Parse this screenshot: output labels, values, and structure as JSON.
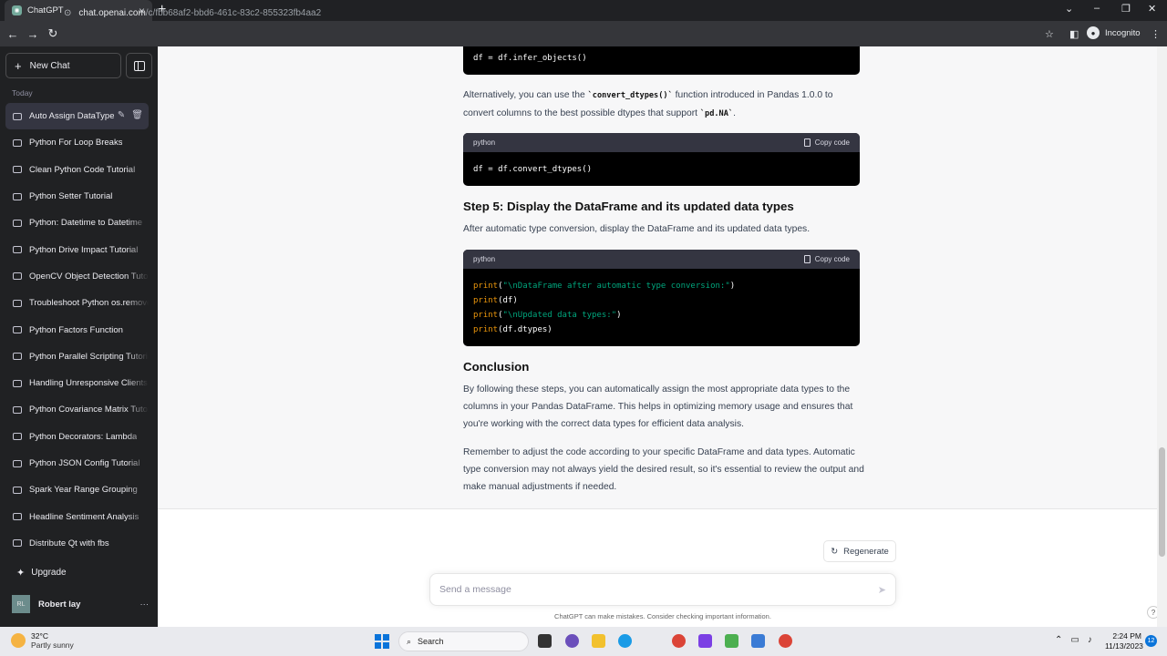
{
  "browser": {
    "tab_title": "ChatGPT",
    "url_host": "chat.openai.com",
    "url_path": "/c/fbb68af2-bbd6-461c-83c2-855323fb4aa2",
    "profile_label": "Incognito"
  },
  "sidebar": {
    "new_chat_label": "New Chat",
    "section_label": "Today",
    "chats": [
      "Auto Assign DataType",
      "Python For Loop Breaks",
      "Clean Python Code Tutorial",
      "Python Setter Tutorial",
      "Python: Datetime to Datetime",
      "Python Drive Impact Tutorial",
      "OpenCV Object Detection Tutorial",
      "Troubleshoot Python os.remove",
      "Python Factors Function",
      "Python Parallel Scripting Tutorial",
      "Handling Unresponsive Clients",
      "Python Covariance Matrix Tutorial",
      "Python Decorators: Lambda",
      "Python JSON Config Tutorial",
      "Spark Year Range Grouping",
      "Headline Sentiment Analysis",
      "Distribute Qt with fbs"
    ],
    "upgrade_label": "Upgrade",
    "user_initials": "RL",
    "user_name": "Robert lay"
  },
  "content": {
    "code1_line": "df = df.infer_objects()",
    "para1_pre": "Alternatively, you can use the ",
    "para1_code1": "`convert_dtypes()`",
    "para1_mid": " function introduced in Pandas 1.0.0 to convert columns to the best possible dtypes that support ",
    "para1_code2": "`pd.NA`",
    "para1_post": ".",
    "code_lang": "python",
    "copy_label": "Copy code",
    "code2_line": "df = df.convert_dtypes()",
    "step5_heading": "Step 5: Display the DataFrame and its updated data types",
    "step5_text": "After automatic type conversion, display the DataFrame and its updated data types.",
    "code3": {
      "l1_fn": "print",
      "l1_str": "\"\\nDataFrame after automatic type conversion:\"",
      "l2_fn": "print",
      "l2_rest": "(df)",
      "l3_fn": "print",
      "l3_str": "\"\\nUpdated data types:\"",
      "l4_fn": "print",
      "l4_rest": "(df.dtypes)"
    },
    "conclusion_heading": "Conclusion",
    "conclusion_p1": "By following these steps, you can automatically assign the most appropriate data types to the columns in your Pandas DataFrame. This helps in optimizing memory usage and ensures that you're working with the correct data types for efficient data analysis.",
    "conclusion_p2": "Remember to adjust the code according to your specific DataFrame and data types. Automatic type conversion may not always yield the desired result, so it's essential to review the output and make manual adjustments if needed."
  },
  "composer": {
    "regenerate_label": "Regenerate",
    "placeholder": "Send a message",
    "disclaimer": "ChatGPT can make mistakes. Consider checking important information.",
    "help_label": "?"
  },
  "taskbar": {
    "temperature": "32°C",
    "weather": "Partly sunny",
    "search_label": "Search",
    "time": "2:24 PM",
    "date": "11/13/2023",
    "notification_count": "12"
  },
  "colors": {
    "sidebar_bg": "#202123",
    "answer_bg": "#f7f7f8",
    "code_bg": "#000000",
    "code_string": "#00a67d"
  }
}
